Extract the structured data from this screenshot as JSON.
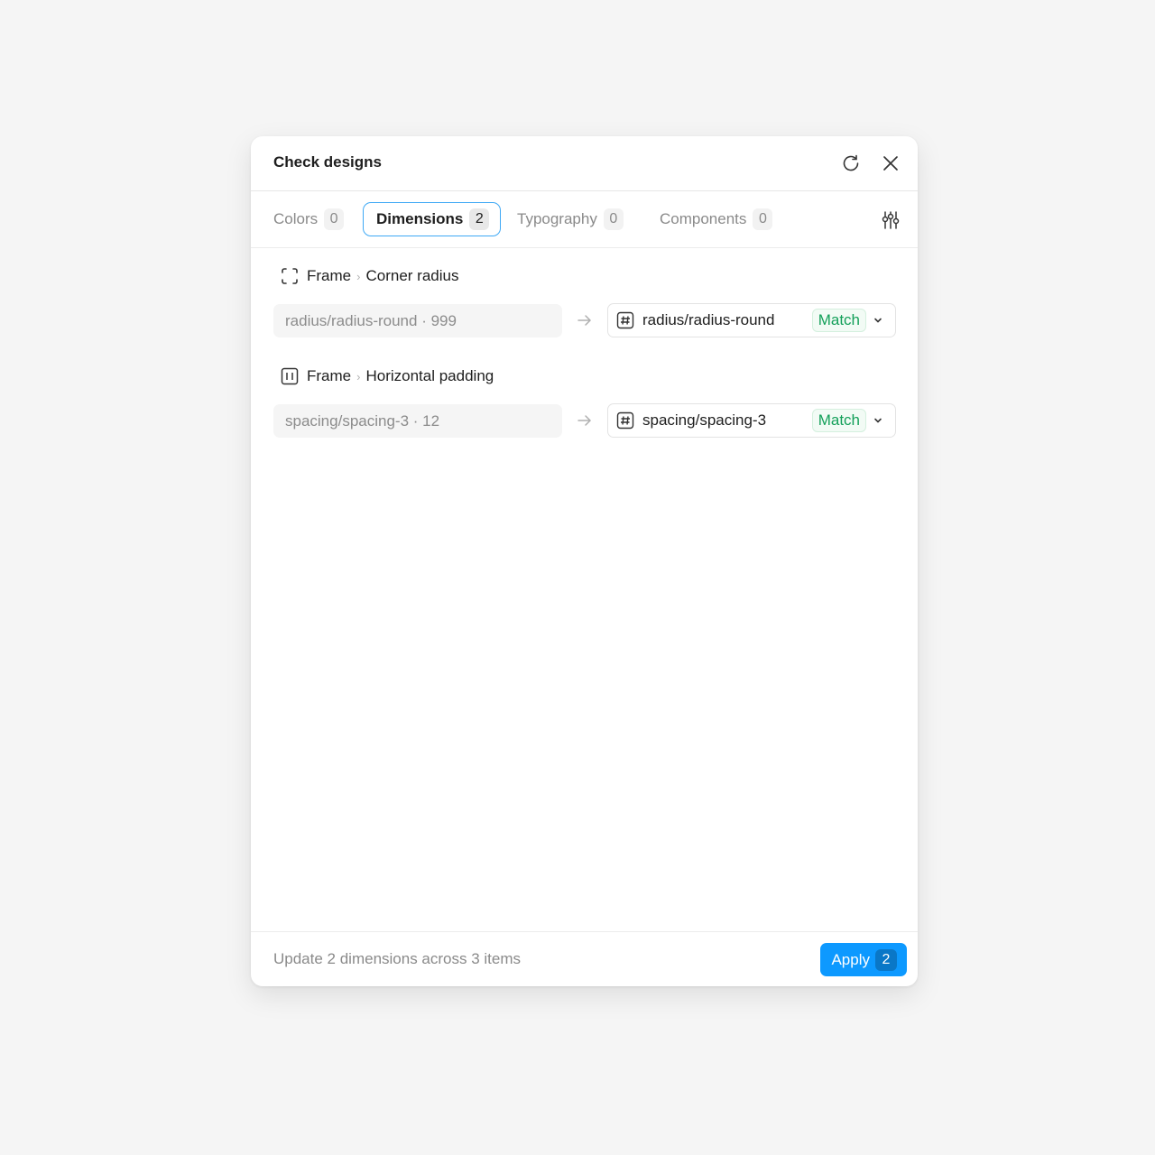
{
  "dialog": {
    "title": "Check designs",
    "refresh_icon": "refresh-icon",
    "close_icon": "close-icon"
  },
  "tabs": [
    {
      "label": "Colors",
      "count": "0",
      "active": false
    },
    {
      "label": "Dimensions",
      "count": "2",
      "active": true
    },
    {
      "label": "Typography",
      "count": "0",
      "active": false
    },
    {
      "label": "Components",
      "count": "0",
      "active": false
    }
  ],
  "filter_icon": "sliders-icon",
  "issues": [
    {
      "icon": "corner-radius-icon",
      "layer": "Frame",
      "property": "Corner radius",
      "current_value": "radius/radius-round · 999",
      "token": "radius/radius-round",
      "status": "Match"
    },
    {
      "icon": "horizontal-padding-icon",
      "layer": "Frame",
      "property": "Horizontal padding",
      "current_value": "spacing/spacing-3 · 12",
      "token": "spacing/spacing-3",
      "status": "Match"
    }
  ],
  "footer": {
    "summary": "Update 2 dimensions across 3 items",
    "apply_label": "Apply",
    "apply_count": "2"
  },
  "colors": {
    "accent": "#0d99ff",
    "active_tab_border": "#3fa9f5",
    "match_green": "#14a05a"
  }
}
